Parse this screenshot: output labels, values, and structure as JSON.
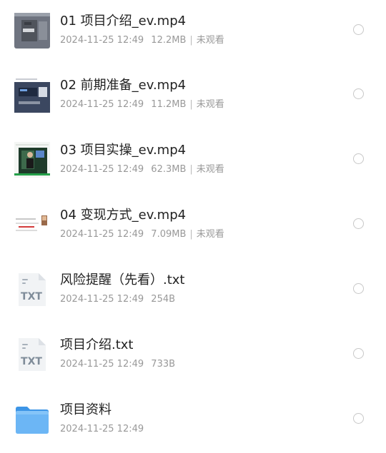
{
  "files": [
    {
      "name": "01 项目介绍_ev.mp4",
      "date": "2024-11-25 12:49",
      "size": "12.2MB",
      "status": "未观看",
      "icon": "video-thumbnail-icon"
    },
    {
      "name": "02 前期准备_ev.mp4",
      "date": "2024-11-25 12:49",
      "size": "11.2MB",
      "status": "未观看",
      "icon": "video-thumbnail-icon"
    },
    {
      "name": "03 项目实操_ev.mp4",
      "date": "2024-11-25 12:49",
      "size": "62.3MB",
      "status": "未观看",
      "icon": "video-thumbnail-icon"
    },
    {
      "name": "04 变现方式_ev.mp4",
      "date": "2024-11-25 12:49",
      "size": "7.09MB",
      "status": "未观看",
      "icon": "video-thumbnail-icon"
    },
    {
      "name": "风险提醒（先看）.txt",
      "date": "2024-11-25 12:49",
      "size": "254B",
      "icon": "txt-file-icon",
      "icon_label": "TXT"
    },
    {
      "name": "项目介绍.txt",
      "date": "2024-11-25 12:49",
      "size": "733B",
      "icon": "txt-file-icon",
      "icon_label": "TXT"
    },
    {
      "name": "项目资料",
      "date": "2024-11-25 12:49",
      "icon": "folder-icon"
    }
  ],
  "colors": {
    "title": "#222222",
    "meta": "#999999",
    "radio_border": "#c7c7c7",
    "folder": "#5aa9f0",
    "txt_badge": "#7f8c99"
  }
}
